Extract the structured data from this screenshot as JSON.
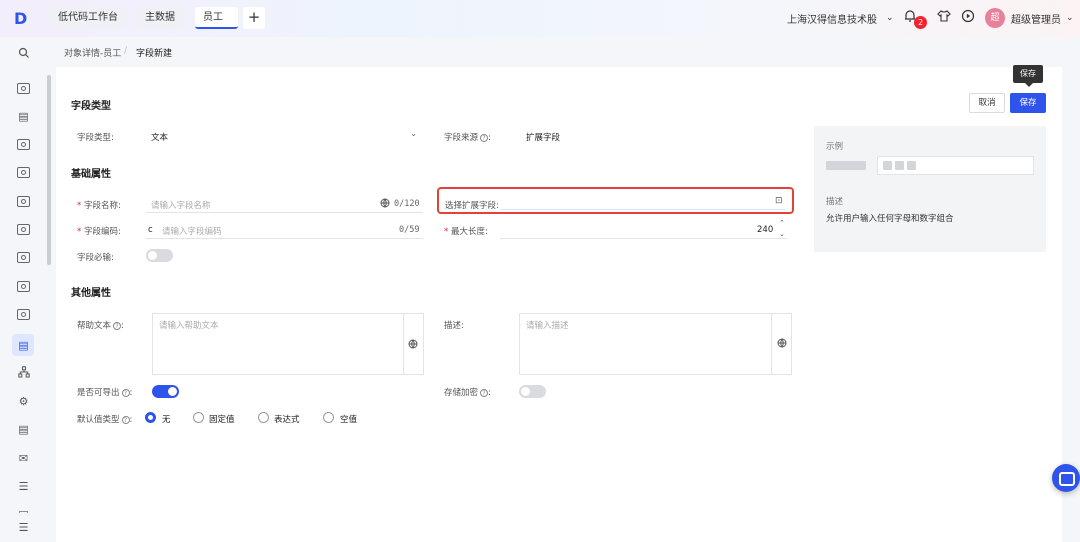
{
  "topbar": {
    "logo": "D",
    "tabs": [
      {
        "label": "低代码工作台"
      },
      {
        "label": "主数据"
      },
      {
        "label": "员工"
      }
    ],
    "add_tab": "+",
    "company": "上海汉得信息技术股",
    "notification_count": "2",
    "avatar_text": "超",
    "user": "超级管理员"
  },
  "breadcrumb": {
    "parent": "对象详情-员工",
    "sep": "/",
    "current": "字段新建"
  },
  "actions": {
    "cancel": "取消",
    "save": "保存",
    "tooltip": "保存"
  },
  "field_type_section": {
    "title": "字段类型",
    "type_label": "字段类型:",
    "type_value": "文本",
    "source_label": "字段来源",
    "source_value": "扩展字段"
  },
  "basic_section": {
    "title": "基础属性",
    "name_label": "字段名称:",
    "name_placeholder": "请输入字段名称",
    "name_counter": "0/120",
    "ext_label": "选择扩展字段:",
    "code_label": "字段编码:",
    "code_prefix": "c",
    "code_placeholder": "请输入字段编码",
    "code_counter": "0/59",
    "maxlen_label": "最大长度:",
    "maxlen_value": "240",
    "required_label": "字段必输:"
  },
  "other_section": {
    "title": "其他属性",
    "help_label": "帮助文本",
    "help_placeholder": "请输入帮助文本",
    "desc_label": "描述:",
    "desc_placeholder": "请输入描述",
    "export_label": "是否可导出",
    "encrypt_label": "存储加密",
    "default_label": "默认值类型",
    "default_options": [
      "无",
      "固定值",
      "表达式",
      "空值"
    ],
    "default_selected": "无"
  },
  "example_panel": {
    "title": "示例",
    "desc_title": "描述",
    "desc_text": "允许用户输入任何字母和数字组合"
  },
  "toggles": {
    "required": false,
    "export": true,
    "encrypt": false
  },
  "colors": {
    "primary": "#2f54eb",
    "highlight": "#e0433a",
    "required": "#f5222d"
  }
}
